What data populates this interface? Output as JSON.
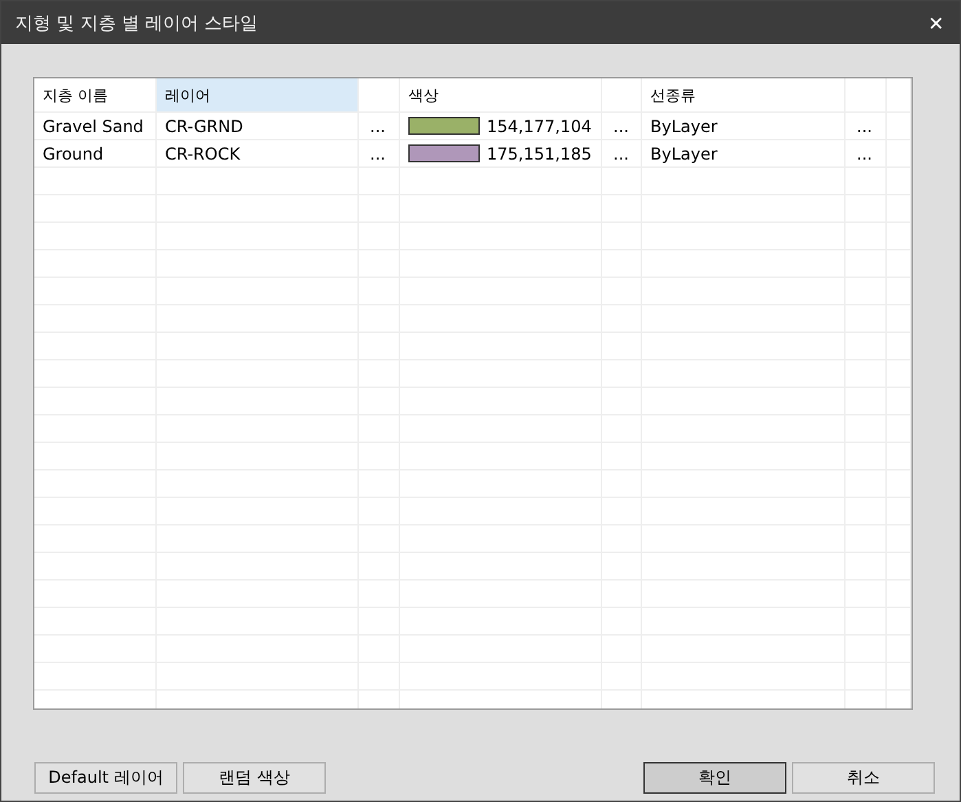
{
  "window": {
    "title": "지형 및 지층 별 레이어 스타일",
    "close": "✕"
  },
  "table": {
    "columns": [
      {
        "label": "지층 이름",
        "selected": false
      },
      {
        "label": "레이어",
        "selected": true
      },
      {
        "label": "색상",
        "selected": false
      },
      {
        "label": "선종류",
        "selected": false
      }
    ],
    "rows": [
      {
        "name": "Gravel Sand",
        "layer": "CR-GRND",
        "color": "#9ab168",
        "color_text": "154,177,104",
        "linetype": "ByLayer",
        "more": "..."
      },
      {
        "name": "Ground",
        "layer": "CR-ROCK",
        "color": "#af97b9",
        "color_text": "175,151,185",
        "linetype": "ByLayer",
        "more": "..."
      }
    ]
  },
  "buttons": [
    {
      "label": "Default 레이어",
      "default": false
    },
    {
      "label": "랜덤 색상",
      "default": false
    },
    {
      "label": "확인",
      "default": true
    },
    {
      "label": "취소",
      "default": false
    }
  ]
}
